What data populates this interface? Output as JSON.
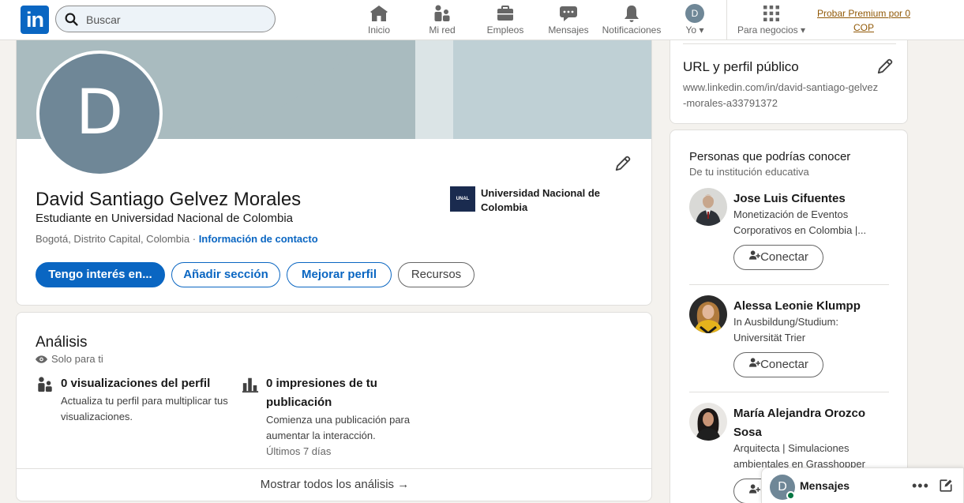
{
  "nav": {
    "logo": "in",
    "search_placeholder": "Buscar",
    "items": [
      {
        "label": "Inicio",
        "icon": "home-icon"
      },
      {
        "label": "Mi red",
        "icon": "network-icon"
      },
      {
        "label": "Empleos",
        "icon": "briefcase-icon"
      },
      {
        "label": "Mensajes",
        "icon": "chat-icon"
      },
      {
        "label": "Notificaciones",
        "icon": "bell-icon"
      },
      {
        "label": "Yo",
        "icon": "avatar"
      }
    ],
    "me_initial": "D",
    "business": "Para negocios",
    "premium": "Probar Premium por 0 COP"
  },
  "profile": {
    "initial": "D",
    "name": "David Santiago Gelvez Morales",
    "headline": "Estudiante en Universidad Nacional de Colombia",
    "location": "Bogotá, Distrito Capital, Colombia",
    "separator": "·",
    "contact_link": "Información de contacto",
    "education_logo_text": "UNAL",
    "education": "Universidad Nacional de Colombia",
    "buttons": {
      "interest": "Tengo interés en...",
      "add_section": "Añadir sección",
      "improve": "Mejorar perfil",
      "resources": "Recursos"
    }
  },
  "analytics": {
    "title": "Análisis",
    "visibility": "Solo para ti",
    "views": {
      "title": "0 visualizaciones del perfil",
      "desc": "Actualiza tu perfil para multiplicar tus visualizaciones."
    },
    "impressions": {
      "title": "0 impresiones de tu publicación",
      "desc": "Comienza una publicación para aumentar la interacción.",
      "meta": "Últimos 7 días"
    },
    "footer": "Mostrar todos los análisis →"
  },
  "public_url": {
    "title": "URL y perfil público",
    "url": "www.linkedin.com/in/david-santiago-gelvez-morales-a33791372"
  },
  "people": {
    "title": "Personas que podrías conocer",
    "subtitle": "De tu institución educativa",
    "connect_label": "Conectar",
    "list": [
      {
        "name": "Jose Luis Cifuentes",
        "desc": "Monetización de Eventos Corporativos en Colombia |..."
      },
      {
        "name": "Alessa Leonie Klumpp",
        "desc": "In Ausbildung/Studium: Universität Trier"
      },
      {
        "name": "María Alejandra Orozco Sosa",
        "desc": "Arquitecta | Simulaciones ambientales en Grasshopper"
      }
    ]
  },
  "messaging": {
    "initial": "D",
    "title": "Mensajes"
  },
  "colors": {
    "brand": "#0a66c2",
    "premium": "#915907",
    "online": "#057642"
  }
}
